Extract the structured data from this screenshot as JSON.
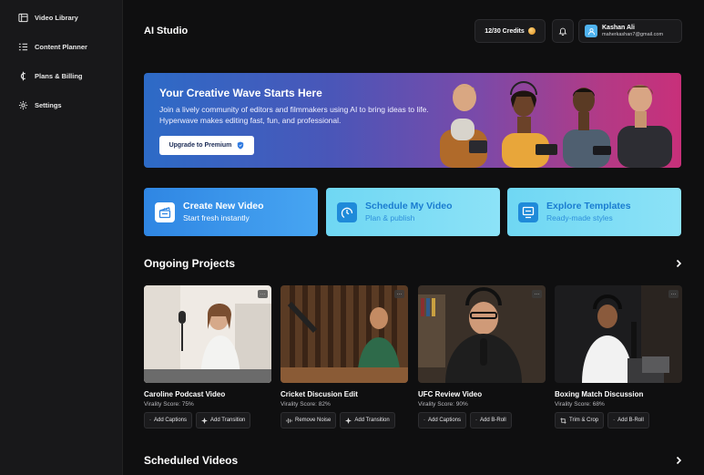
{
  "sidebar": {
    "items": [
      {
        "label": "Video Library",
        "icon": "video-library-icon"
      },
      {
        "label": "Content Planner",
        "icon": "list-icon"
      },
      {
        "label": "Plans & Billing",
        "icon": "currency-icon"
      },
      {
        "label": "Settings",
        "icon": "gear-icon"
      }
    ]
  },
  "header": {
    "title": "AI Studio",
    "credits": "12/30 Credits",
    "user_name": "Kashan Ali",
    "user_email": "maherkashan7@gmail.com"
  },
  "hero": {
    "title": "Your Creative Wave Starts Here",
    "subtitle": "Join a lively community of editors and filmmakers using AI to bring ideas to life. Hyperwave makes editing fast, fun, and professional.",
    "cta": "Upgrade to Premium"
  },
  "quick_actions": [
    {
      "title": "Create New Video",
      "subtitle": "Start fresh instantly"
    },
    {
      "title": "Schedule My Video",
      "subtitle": "Plan & publish"
    },
    {
      "title": "Explore Templates",
      "subtitle": "Ready-made styles"
    }
  ],
  "ongoing": {
    "title": "Ongoing Projects",
    "projects": [
      {
        "title": "Caroline Podcast Video",
        "score": "Virality Score: 75%",
        "tags": [
          "Add Captions",
          "Add Transition"
        ]
      },
      {
        "title": "Cricket Discusion Edit",
        "score": "Virality Score: 82%",
        "tags": [
          "Remove Noise",
          "Add Transition"
        ]
      },
      {
        "title": "UFC Review Video",
        "score": "Virality Score: 90%",
        "tags": [
          "Add Captions",
          "Add B-Roll"
        ]
      },
      {
        "title": "Boxing Match Discussion",
        "score": "Virality Score: 68%",
        "tags": [
          "Trim & Crop",
          "Add B-Roll"
        ]
      }
    ]
  },
  "scheduled": {
    "title": "Scheduled Videos"
  },
  "colors": {
    "accent": "#2f86e3",
    "light_accent": "#8ce2f7",
    "background": "#0f0f10",
    "sidebar": "#18181a"
  }
}
